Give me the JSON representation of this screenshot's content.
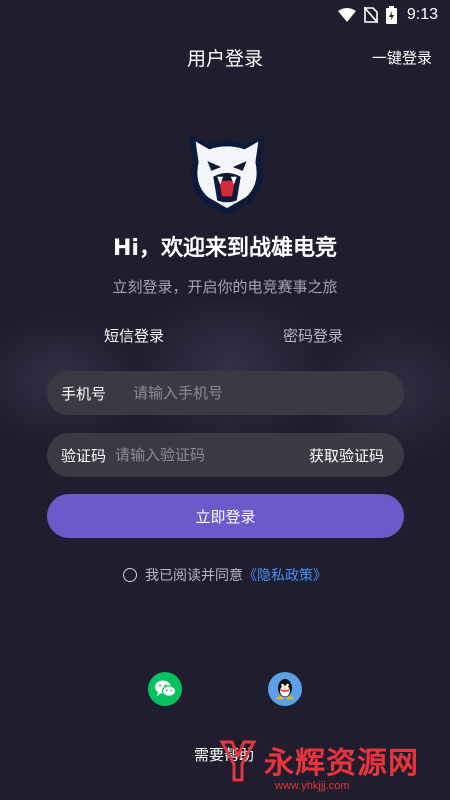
{
  "status_bar": {
    "time": "9:13"
  },
  "header": {
    "title": "用户登录",
    "action": "一键登录"
  },
  "welcome": {
    "headline": "Hi，欢迎来到战雄电竞",
    "subtitle": "立刻登录，开启你的电竞赛事之旅"
  },
  "tabs": [
    {
      "label": "短信登录"
    },
    {
      "label": "密码登录"
    }
  ],
  "phone": {
    "label": "手机号",
    "placeholder": "请输入手机号",
    "value": ""
  },
  "code": {
    "label": "验证码",
    "placeholder": "请输入验证码",
    "value": "",
    "action": "获取验证码"
  },
  "login_button": "立即登录",
  "agreement": {
    "text": "我已阅读并同意",
    "link": "《隐私政策》"
  },
  "social": [
    {
      "icon": "wechat-icon"
    },
    {
      "icon": "qq-icon"
    }
  ],
  "bottom_text": "需要帮助",
  "watermark": {
    "text": "永辉资源网",
    "url": "www.yhkjjj.com"
  },
  "colors": {
    "background": "#1f1d2e",
    "accent": "#6b5ac9",
    "field": "#3b3a44",
    "link": "#4a8ff0",
    "wechat": "#07c160",
    "qq": "#5aa0e8",
    "watermark": "#e8343a"
  }
}
